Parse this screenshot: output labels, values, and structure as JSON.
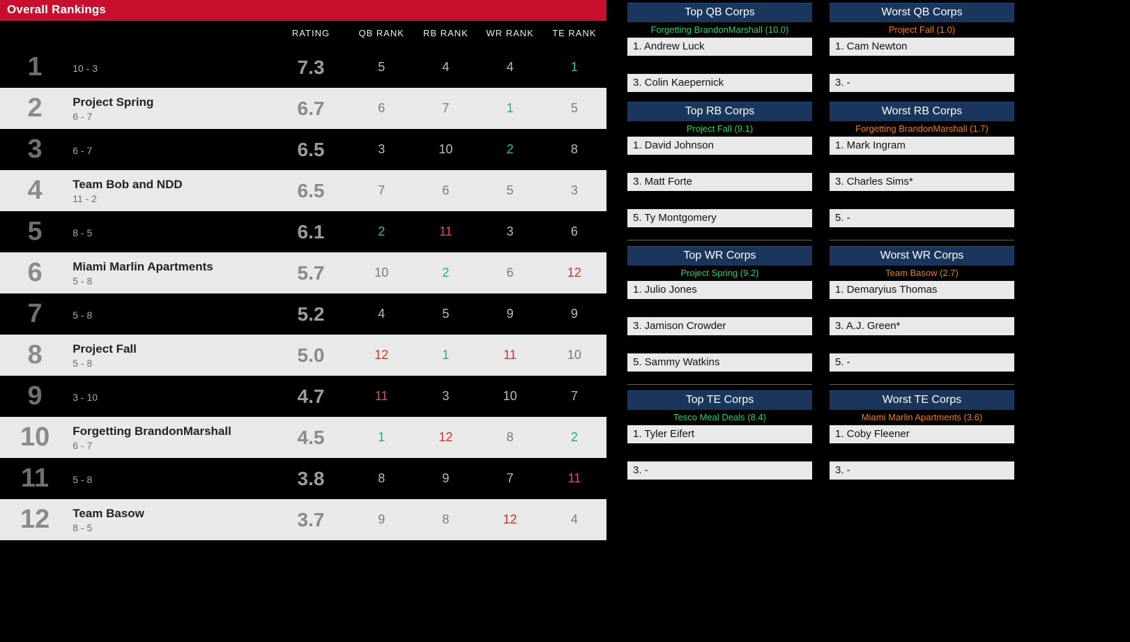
{
  "title": "Overall Rankings",
  "headers": {
    "rating": "RATING",
    "qb": "QB RANK",
    "rb": "RB RANK",
    "wr": "WR RANK",
    "te": "TE RANK"
  },
  "rows": [
    {
      "rank": "1",
      "team": "",
      "rec": "10 - 3",
      "rating": "7.3",
      "qb": "5",
      "rb": "4",
      "wr": "4",
      "te": "1"
    },
    {
      "rank": "2",
      "team": "Project Spring",
      "rec": "6 - 7",
      "rating": "6.7",
      "qb": "6",
      "rb": "7",
      "wr": "1",
      "te": "5"
    },
    {
      "rank": "3",
      "team": "",
      "rec": "6 - 7",
      "rating": "6.5",
      "qb": "3",
      "rb": "10",
      "wr": "2",
      "te": "8"
    },
    {
      "rank": "4",
      "team": "Team Bob and NDD",
      "rec": "11 - 2",
      "rating": "6.5",
      "qb": "7",
      "rb": "6",
      "wr": "5",
      "te": "3"
    },
    {
      "rank": "5",
      "team": "",
      "rec": "8 - 5",
      "rating": "6.1",
      "qb": "2",
      "rb": "11",
      "wr": "3",
      "te": "6"
    },
    {
      "rank": "6",
      "team": "Miami Marlin Apartments",
      "rec": "5 - 8",
      "rating": "5.7",
      "qb": "10",
      "rb": "2",
      "wr": "6",
      "te": "12"
    },
    {
      "rank": "7",
      "team": "",
      "rec": "5 - 8",
      "rating": "5.2",
      "qb": "4",
      "rb": "5",
      "wr": "9",
      "te": "9"
    },
    {
      "rank": "8",
      "team": "Project Fall",
      "rec": "5 - 8",
      "rating": "5.0",
      "qb": "12",
      "rb": "1",
      "wr": "11",
      "te": "10"
    },
    {
      "rank": "9",
      "team": "",
      "rec": "3 - 10",
      "rating": "4.7",
      "qb": "11",
      "rb": "3",
      "wr": "10",
      "te": "7"
    },
    {
      "rank": "10",
      "team": "Forgetting BrandonMarshall",
      "rec": "6 - 7",
      "rating": "4.5",
      "qb": "1",
      "rb": "12",
      "wr": "8",
      "te": "2"
    },
    {
      "rank": "11",
      "team": "",
      "rec": "5 - 8",
      "rating": "3.8",
      "qb": "8",
      "rb": "9",
      "wr": "7",
      "te": "11"
    },
    {
      "rank": "12",
      "team": "Team Basow",
      "rec": "8 - 5",
      "rating": "3.7",
      "qb": "9",
      "rb": "8",
      "wr": "12",
      "te": "4"
    }
  ],
  "corps": {
    "top": [
      {
        "title": "Top QB Corps",
        "sub": "Forgetting BrandonMarshall (10.0)",
        "rows": [
          "1. Andrew Luck",
          "3. Colin Kaepernick"
        ]
      },
      {
        "title": "Top RB Corps",
        "sub": "Project Fall (9.1)",
        "rows": [
          "1. David Johnson",
          "3. Matt Forte",
          "5. Ty Montgomery"
        ]
      },
      {
        "title": "Top WR Corps",
        "sub": "Project Spring (9.2)",
        "rows": [
          "1. Julio Jones",
          "3. Jamison Crowder",
          "5. Sammy Watkins"
        ]
      },
      {
        "title": "Top TE Corps",
        "sub": "Tesco Meal Deals (8.4)",
        "rows": [
          "1. Tyler Eifert",
          "3. -"
        ]
      }
    ],
    "bot": [
      {
        "title": "Worst QB Corps",
        "sub": "Project Fall (1.0)",
        "rows": [
          "1. Cam Newton",
          "3. -"
        ]
      },
      {
        "title": "Worst RB Corps",
        "sub": "Forgetting BrandonMarshall (1.7)",
        "rows": [
          "1. Mark Ingram",
          "3. Charles Sims*",
          "5. -"
        ]
      },
      {
        "title": "Worst WR Corps",
        "sub": "Team Basow (2.7)",
        "rows": [
          "1. Demaryius Thomas",
          "3. A.J. Green*",
          "5. -"
        ]
      },
      {
        "title": "Worst TE Corps",
        "sub": "Miami Marlin Apartments (3.6)",
        "rows": [
          "1. Coby Fleener",
          "3. -"
        ]
      }
    ]
  }
}
